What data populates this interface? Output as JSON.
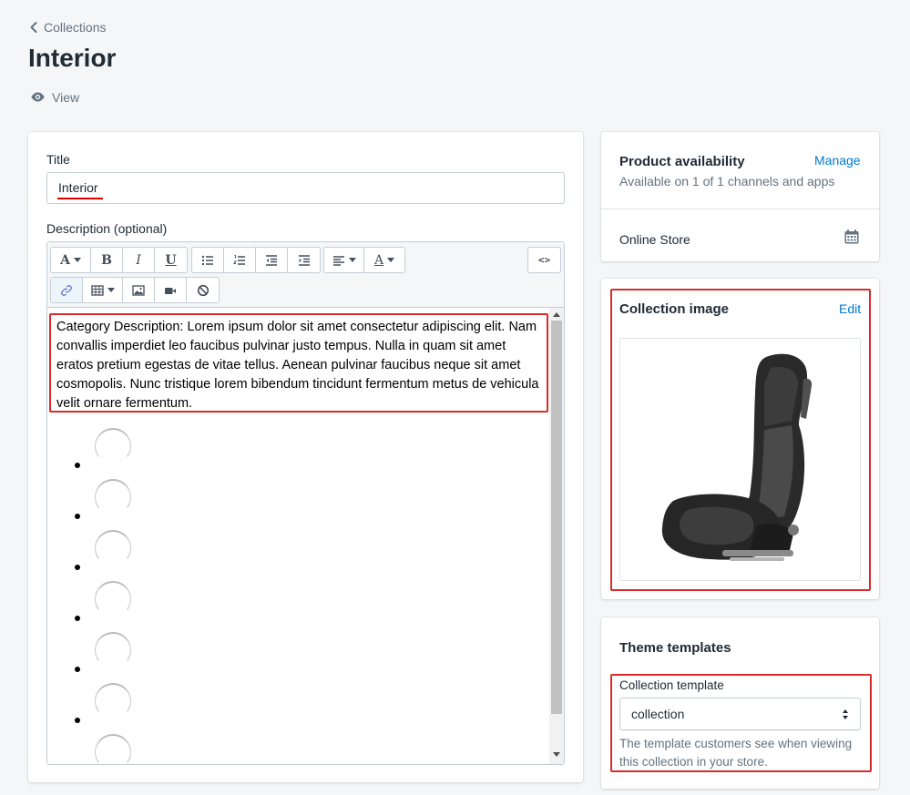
{
  "breadcrumb": {
    "label": "Collections"
  },
  "page": {
    "title": "Interior",
    "view_label": "View"
  },
  "form": {
    "title_label": "Title",
    "title_value": "Interior",
    "description_label": "Description (optional)",
    "description_text": "Category Description: Lorem ipsum dolor sit amet consectetur adipiscing elit. Nam convallis imperdiet leo faucibus pulvinar justo tempus. Nulla in quam sit amet eratos pretium egestas de vitae tellus. Aenean pulvinar faucibus neque sit amet cosmopolis. Nunc tristique lorem bibendum tincidunt fermentum metus de vehicula velit ornare fermentum."
  },
  "toolbar": {
    "row1": [
      {
        "name": "font-dropdown",
        "glyph": "A",
        "dropdown": true
      },
      {
        "name": "bold-button",
        "glyph": "B"
      },
      {
        "name": "italic-button",
        "glyph": "I"
      },
      {
        "name": "underline-button",
        "glyph": "U"
      },
      {
        "name": "bullet-list-button",
        "icon": "bullet-list-icon"
      },
      {
        "name": "numbered-list-button",
        "icon": "numbered-list-icon"
      },
      {
        "name": "outdent-button",
        "icon": "outdent-icon"
      },
      {
        "name": "indent-button",
        "icon": "indent-icon"
      },
      {
        "name": "align-dropdown",
        "icon": "align-left-icon",
        "dropdown": true
      },
      {
        "name": "text-color-dropdown",
        "glyph": "A",
        "dropdown": true
      },
      {
        "name": "html-view-button",
        "glyph": "<>"
      }
    ],
    "row2": [
      {
        "name": "link-button",
        "icon": "link-icon"
      },
      {
        "name": "table-dropdown",
        "icon": "table-icon",
        "dropdown": true
      },
      {
        "name": "insert-image-button",
        "icon": "image-icon"
      },
      {
        "name": "insert-video-button",
        "icon": "video-icon"
      },
      {
        "name": "clear-formatting-button",
        "icon": "clear-formatting-icon"
      }
    ]
  },
  "editor_list_items": 6,
  "availability": {
    "title": "Product availability",
    "manage_label": "Manage",
    "subtitle": "Available on 1 of 1 channels and apps",
    "channel": "Online Store",
    "channel_icon": "calendar-icon"
  },
  "collection_image": {
    "title": "Collection image",
    "edit_label": "Edit",
    "image": "car-seat-photo"
  },
  "theme_templates": {
    "title": "Theme templates",
    "template_label": "Collection template",
    "template_value": "collection",
    "help_text": "The template customers see when viewing this collection in your store."
  },
  "colors": {
    "accent_link": "#007ace",
    "highlight_outline": "#d82c2c",
    "background": "#f4f6f8"
  }
}
